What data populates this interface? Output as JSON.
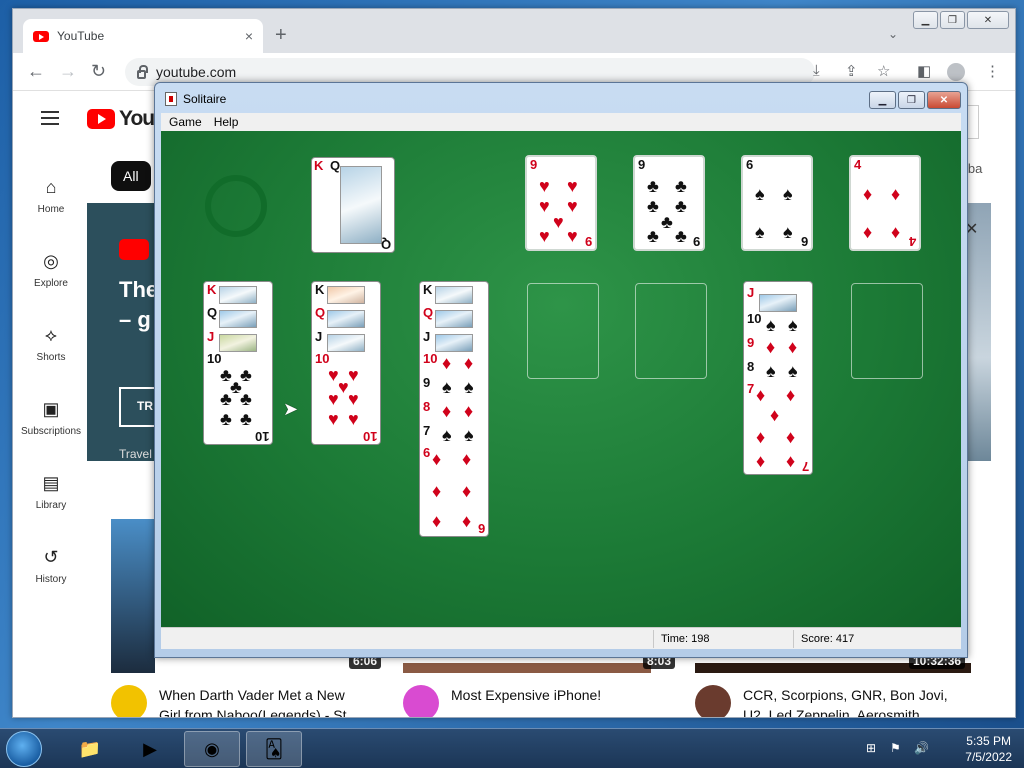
{
  "browser": {
    "tab_title": "YouTube",
    "address": "youtube.com",
    "new_tab": "+",
    "tab_close": "×"
  },
  "youtube": {
    "sidebar": [
      {
        "label": "Home",
        "icon": "⌂"
      },
      {
        "label": "Explore",
        "icon": "◎"
      },
      {
        "label": "Shorts",
        "icon": "⟡"
      },
      {
        "label": "Subscriptions",
        "icon": "▣"
      },
      {
        "label": "Library",
        "icon": "▤"
      },
      {
        "label": "History",
        "icon": "↺"
      }
    ],
    "logo_text": "You",
    "chip_all": "All",
    "chip_edge": "etba",
    "banner_title_1": "The",
    "banner_title_2": "– g",
    "banner_button": "TR",
    "banner_sub": "Travel",
    "videos": [
      {
        "title": "When Darth Vader Met a New",
        "title2": "Girl from Naboo(Legends) - St",
        "duration": "6:06"
      },
      {
        "title": "Most Expensive iPhone!",
        "duration": "8:03"
      },
      {
        "title": "CCR, Scorpions, GNR, Bon Jovi,",
        "title2": "U2, Led Zeppelin, Aerosmith",
        "duration": "10:32:36"
      }
    ]
  },
  "solitaire": {
    "title": "Solitaire",
    "menu": [
      "Game",
      "Help"
    ],
    "time_label": "Time:",
    "time": "198",
    "score_label": "Score:",
    "score": "417",
    "waste": {
      "rank": "Q",
      "suit": "♠",
      "under": "K"
    },
    "foundations": [
      {
        "rank": "9",
        "suit": "♥",
        "color": "red"
      },
      {
        "rank": "9",
        "suit": "♣",
        "color": "black"
      },
      {
        "rank": "6",
        "suit": "♠",
        "color": "black"
      },
      {
        "rank": "4",
        "suit": "♦",
        "color": "red"
      }
    ],
    "tableau": [
      {
        "cards": [
          "K♥",
          "Q♣",
          "J♥",
          "10♣"
        ]
      },
      {
        "cards": [
          "K♠",
          "Q♥",
          "J♠",
          "10♥"
        ]
      },
      {
        "cards": [
          "K♣",
          "Q♦",
          "J♠",
          "10♦",
          "9♠",
          "8♦",
          "7♠",
          "6♦"
        ]
      },
      {
        "cards": []
      },
      {
        "cards": []
      },
      {
        "cards": [
          "J♥",
          "10♠",
          "9♦",
          "8♠",
          "7♦"
        ]
      },
      {
        "cards": []
      }
    ]
  },
  "taskbar": {
    "time": "5:35 PM",
    "date": "7/5/2022"
  }
}
